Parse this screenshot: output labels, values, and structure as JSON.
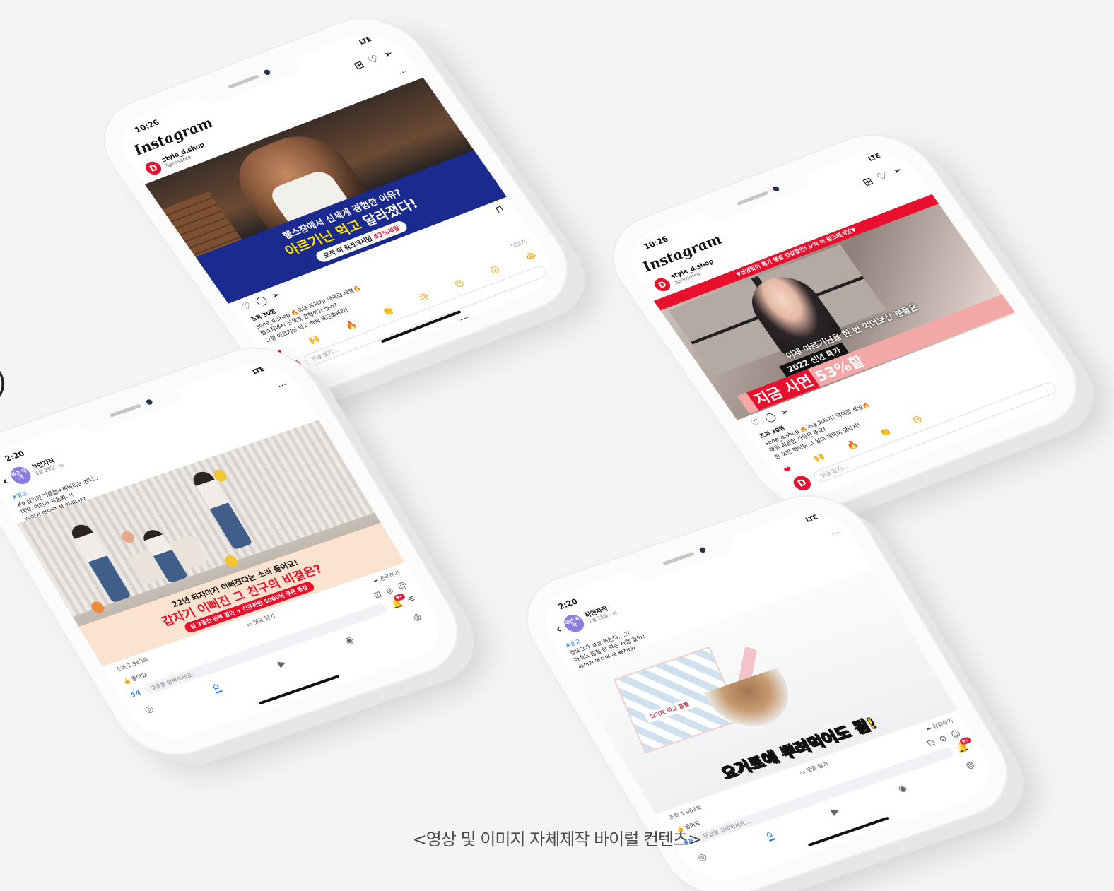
{
  "caption": "<영상 및 이미지 자체제작 바이럴 컨텐츠>",
  "edge_mark": ")",
  "common": {
    "ig_logo": "Instagram",
    "ig_time": "10:26",
    "ig_status": "LTE",
    "ig_user": "style_d.shop",
    "ig_sponsored": "Sponsored",
    "ig_more_link": "더보기",
    "ig_comment_placeholder": "댓글 달기...",
    "fb_time": "2:20",
    "fb_status": "LTE",
    "fb_page_name": "하얀자작",
    "fb_avatar_text": "하얀 자작",
    "fb_post_date": "1월 25일 · ◎",
    "fb_ad_tag": "#광고",
    "fb_views": "조회 1,963회",
    "fb_comment_btn": "댓글 달기",
    "fb_share_btn": "공유하기",
    "fb_like_btn": "좋아요",
    "fb_reaction_count": "9개",
    "fb_comment_placeholder": "댓글을 입력하세요...",
    "fb_badge": "9+",
    "brand_color": "#e8102c",
    "fb_blue": "#1877f2"
  },
  "phone1": {
    "media": {
      "line1": "헬스장에서 신세계 경험한 이유?",
      "line2_hl": "아르기닌 먹고",
      "line2_rest": "달라졌다!",
      "pill_text": "오직 이 링크에서만",
      "pill_hl": "53%세일"
    },
    "views": "조회 30명",
    "caption_lines": [
      "style_d.shop 🔥국내 최저가! 역대급 세일🔥",
      "헬스장에서 신세계 경험하고 싶어?",
      "그럼 아르기닌 먹고 하체 폭근해봐라!"
    ],
    "emojis": [
      "❤",
      "🙌",
      "🔥",
      "👏",
      "😢",
      "😍",
      "😮",
      "😂"
    ]
  },
  "phone2": {
    "media": {
      "top_band": "▼신년맞이 특가 행정 반값할인! 오직 이 링크에서만▼",
      "subtitle": "이제 아르기닌을 한 번 먹어보신 분들은",
      "tag": "2022 신년 특가",
      "big_hl": "지금 사면",
      "big_rest": "53%할"
    },
    "views": "조회 30명",
    "caption_lines": [
      "style_d.shop 🔥국내 최저가! 역대급 세일🔥",
      "매일 피곤한 사람은 주목!",
      "한 포만 먹어도 그 날의 체력이 달라져!"
    ],
    "emojis": [
      "❤",
      "🙌",
      "🔥",
      "👏",
      "😢"
    ]
  },
  "phone3": {
    "post_lines": [
      "#o 신기한 기름흡수해버리는 캔디..",
      "대박..이런거 처음봐..!!",
      "@이거 먹으면 살 안찌나??"
    ],
    "media": {
      "line1": "22년 되자마자 이뻐졌다는 소리 들어요!",
      "line2": "갑자기 이뻐진 그 친구의 비결은?",
      "pill": "단 3일간 반짝 할인 + 신규회원 5000원 쿠폰 증정"
    }
  },
  "phone4": {
    "post_lines": [
      "찹도그가 살살 녹는다....?!",
      "아직도 흡혈 한 먹는 사람 있어?",
      "@이거 먹으면 살 빠진대!"
    ],
    "media": {
      "box_label": "요거트 먹고 흡혈",
      "banner": "요거트에 뿌려먹어도 됨!"
    }
  }
}
